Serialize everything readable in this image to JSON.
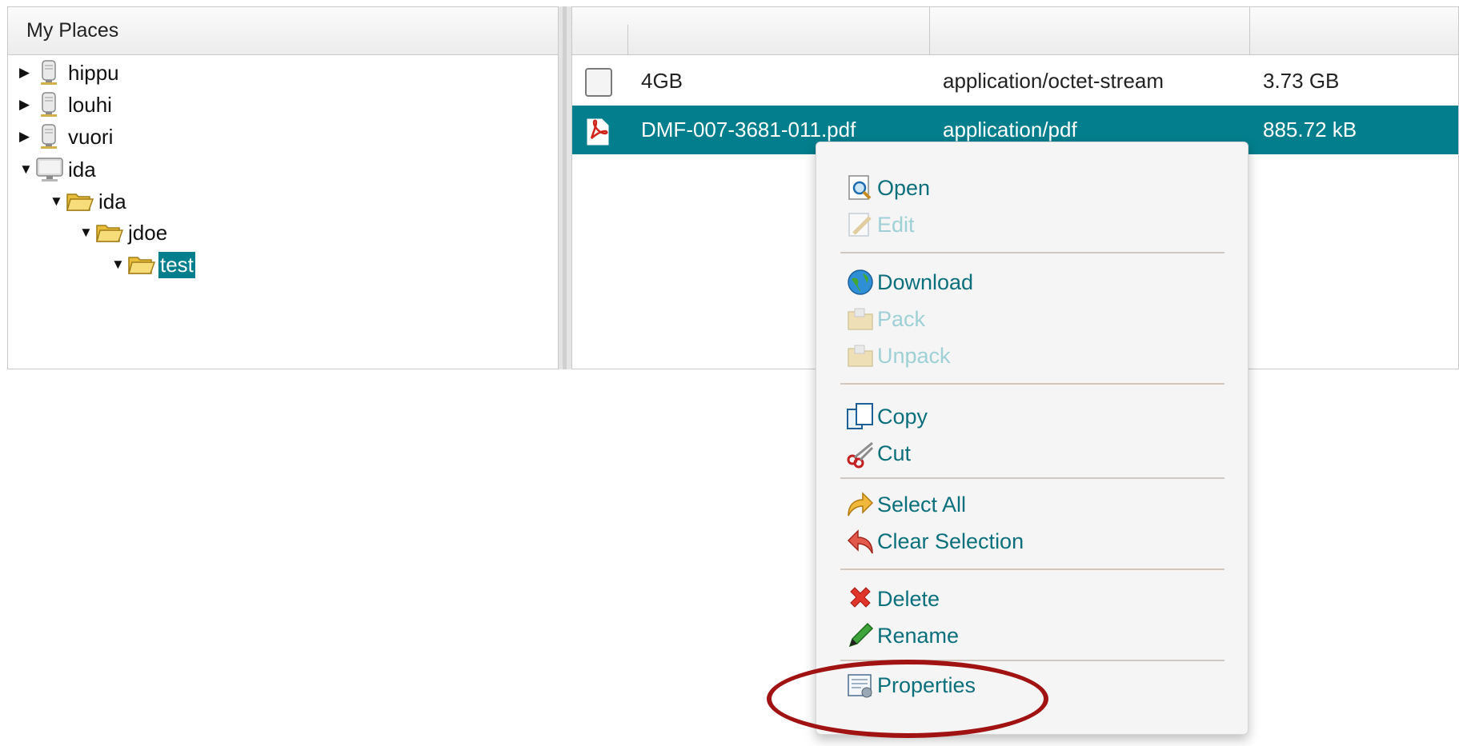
{
  "places_panel": {
    "title": "My Places",
    "tree": [
      {
        "label": "hippu",
        "expanded": false,
        "icon": "server-icon"
      },
      {
        "label": "louhi",
        "expanded": false,
        "icon": "server-icon"
      },
      {
        "label": "vuori",
        "expanded": false,
        "icon": "server-icon"
      },
      {
        "label": "ida",
        "expanded": true,
        "icon": "computer-icon"
      },
      {
        "label": "ida",
        "expanded": true,
        "icon": "folder-open-icon"
      },
      {
        "label": "jdoe",
        "expanded": true,
        "icon": "folder-open-icon"
      },
      {
        "label": "test",
        "expanded": true,
        "icon": "folder-open-icon",
        "selected": true
      }
    ],
    "arrows": {
      "collapsed": "▶",
      "expanded": "▼"
    }
  },
  "file_list": {
    "rows": [
      {
        "name": "4GB",
        "type": "application/octet-stream",
        "size": "3.73 GB",
        "icon": "file-generic-icon",
        "selected": false
      },
      {
        "name": "DMF-007-3681-011.pdf",
        "type": "application/pdf",
        "size": "885.72 kB",
        "icon": "pdf-icon",
        "selected": true
      }
    ]
  },
  "context_menu": {
    "items": [
      {
        "label": "Open",
        "icon": "open-magnifier-icon",
        "enabled": true
      },
      {
        "label": "Edit",
        "icon": "edit-icon",
        "enabled": false
      },
      {
        "label": "Download",
        "icon": "globe-download-icon",
        "enabled": true
      },
      {
        "label": "Pack",
        "icon": "pack-icon",
        "enabled": false
      },
      {
        "label": "Unpack",
        "icon": "unpack-icon",
        "enabled": false
      },
      {
        "label": "Copy",
        "icon": "copy-icon",
        "enabled": true
      },
      {
        "label": "Cut",
        "icon": "scissors-icon",
        "enabled": true
      },
      {
        "label": "Select All",
        "icon": "select-all-arrow-icon",
        "enabled": true
      },
      {
        "label": "Clear Selection",
        "icon": "clear-selection-arrow-icon",
        "enabled": true
      },
      {
        "label": "Delete",
        "icon": "delete-x-icon",
        "enabled": true
      },
      {
        "label": "Rename",
        "icon": "pencil-icon",
        "enabled": true
      },
      {
        "label": "Properties",
        "icon": "properties-icon",
        "enabled": true
      }
    ],
    "highlighted_item": "Properties"
  },
  "colors": {
    "selection": "#037e8c",
    "menu_text": "#0b6f7c",
    "menu_text_disabled": "#9fd0d6",
    "annotation": "#a11212"
  }
}
